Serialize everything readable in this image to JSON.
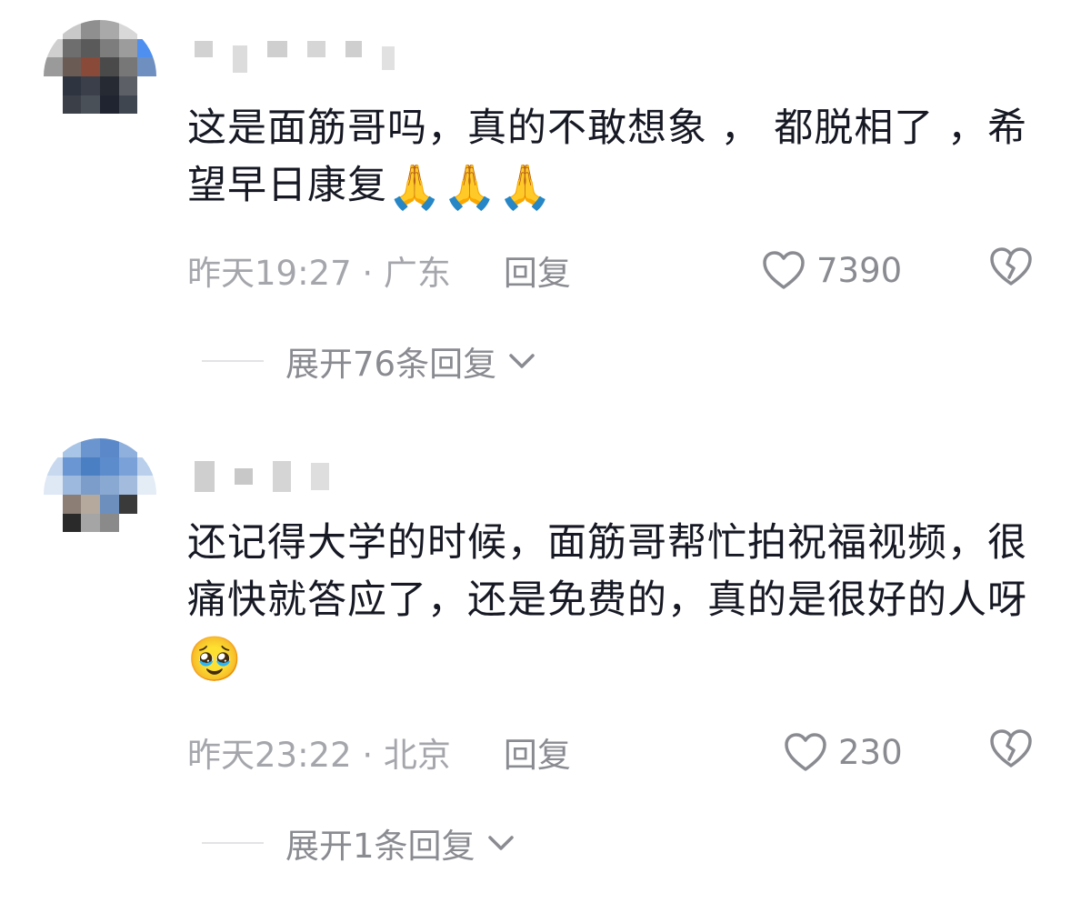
{
  "comments": [
    {
      "text": "这是面筋哥吗，真的不敢想象 ， 都脱相了 ，希望早日康复",
      "emoji": "🙏🙏🙏",
      "time": "昨天19:27 · 广东",
      "reply_label": "回复",
      "likes": "7390",
      "expand_label": "展开76条回复"
    },
    {
      "text": "还记得大学的时候，面筋哥帮忙拍祝福视频，很痛快就答应了，还是免费的，真的是很好的人呀",
      "emoji": "🥹",
      "time": "昨天23:22 · 北京",
      "reply_label": "回复",
      "likes": "230",
      "expand_label": "展开1条回复"
    }
  ],
  "icons": {
    "like": "heart-outline-icon",
    "dislike": "broken-heart-icon",
    "expand": "chevron-down-icon"
  },
  "colors": {
    "text": "#161823",
    "meta": "#a5a6ab",
    "action": "#8a8b91"
  }
}
